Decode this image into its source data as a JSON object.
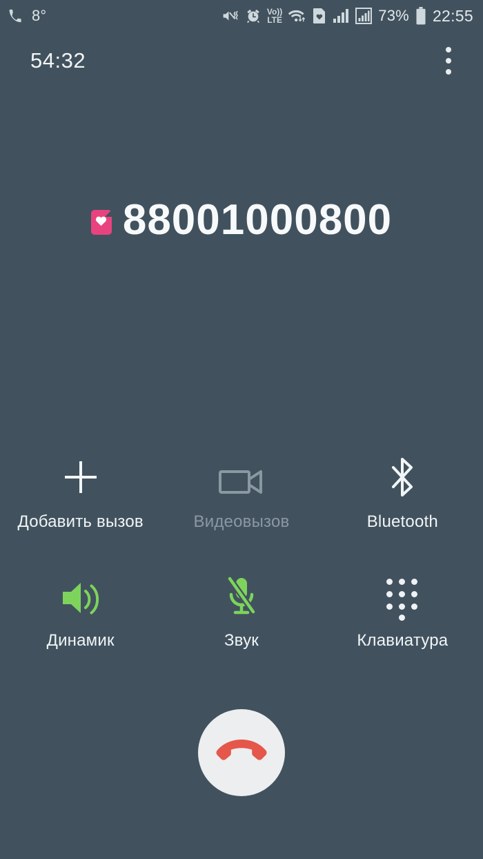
{
  "status_bar": {
    "temperature": "8°",
    "phone_icon": "phone-handset-icon",
    "icons": [
      "sound-off-vibrate-icon",
      "alarm-clock-icon",
      "volte-icon",
      "wifi-transfer-icon",
      "sim-heart-icon",
      "signal-bars-sim1-icon",
      "signal-bars-sim2-icon"
    ],
    "volte_label_top": "Vo))",
    "volte_label_bottom": "LTE",
    "battery_percent": "73%",
    "clock": "22:55"
  },
  "call": {
    "duration": "54:32",
    "overflow_menu": "more-options",
    "number": "88001000800",
    "sim_badge_icon": "sim-heart-icon"
  },
  "actions": [
    {
      "id": "add-call",
      "label": "Добавить вызов",
      "icon": "plus-icon",
      "state": "enabled"
    },
    {
      "id": "video-call",
      "label": "Видеовызов",
      "icon": "video-camera-icon",
      "state": "disabled"
    },
    {
      "id": "bluetooth",
      "label": "Bluetooth",
      "icon": "bluetooth-icon",
      "state": "enabled"
    },
    {
      "id": "speaker",
      "label": "Динамик",
      "icon": "speaker-icon",
      "state": "active"
    },
    {
      "id": "mute",
      "label": "Звук",
      "icon": "microphone-off-icon",
      "state": "active"
    },
    {
      "id": "keypad",
      "label": "Клавиатура",
      "icon": "dialpad-icon",
      "state": "enabled"
    }
  ],
  "end_call": {
    "label": "end-call",
    "icon": "end-call-handset-icon"
  },
  "colors": {
    "background": "#41525e",
    "text": "#f0f4f6",
    "disabled": "#8a98a2",
    "active_green": "#7ed35c",
    "sim_pink": "#e8437f",
    "end_call_red": "#e4574a",
    "end_call_circle": "#eceeef"
  }
}
